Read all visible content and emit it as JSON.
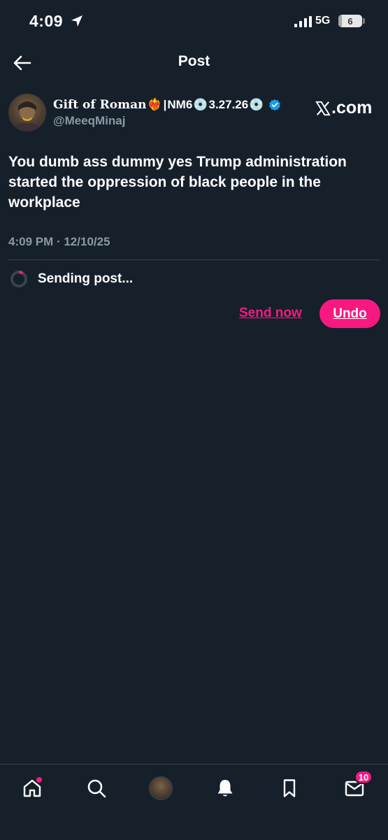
{
  "status_bar": {
    "time": "4:09",
    "network": "5G",
    "battery_level": "6",
    "battery_fraction": 0.06
  },
  "header": {
    "title": "Post",
    "back_icon": "arrow-left-icon"
  },
  "post": {
    "author": {
      "name_text": "Gift of Roman",
      "name_emoji": "❤️‍🔥",
      "name_separator": "|",
      "name_suffix": "NM6",
      "disc_emoji": "💿",
      "date_tag": "3.27.26",
      "verified": true,
      "handle": "@MeeqMinaj"
    },
    "brand": ".com",
    "text": "You dumb ass dummy yes Trump administration started the oppression of black people in the workplace",
    "timestamp": "4:09 PM · 12/10/25"
  },
  "sending": {
    "label": "Sending post...",
    "send_now_label": "Send now",
    "undo_label": "Undo"
  },
  "bottom_nav": {
    "items": [
      "home-icon",
      "search-icon",
      "profile-avatar",
      "bell-icon",
      "bookmark-icon",
      "mail-icon"
    ],
    "messages_badge": "10"
  },
  "colors": {
    "background": "#15202b",
    "accent": "#f91880",
    "secondary_text": "#8b98a5",
    "verified": "#1d9bf0",
    "divider": "#38444d"
  }
}
